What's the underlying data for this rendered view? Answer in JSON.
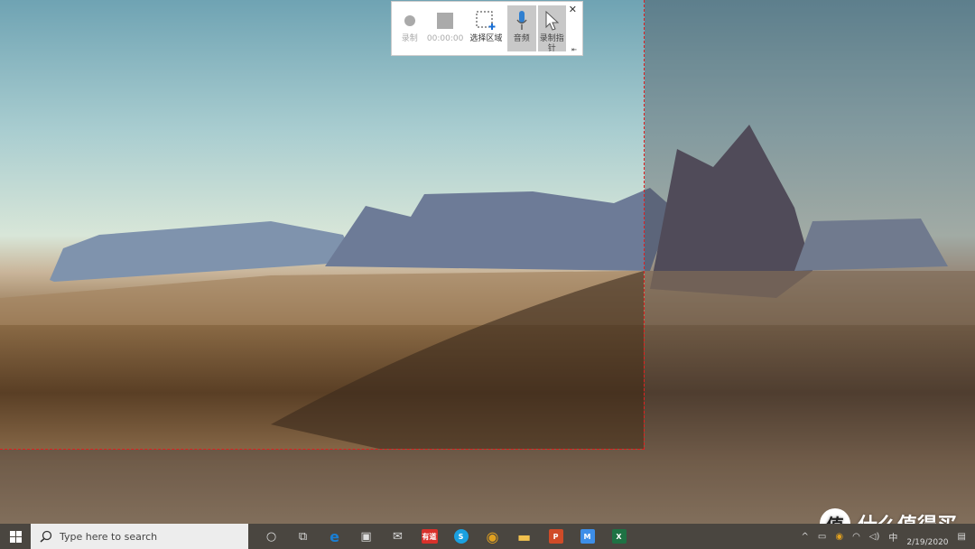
{
  "toolbar": {
    "items": [
      {
        "label": "录制",
        "icon": "record-icon",
        "state": "disabled"
      },
      {
        "label": "00:00:00",
        "icon": "stop-icon",
        "state": "disabled"
      },
      {
        "label": "选择区域",
        "icon": "select-area-icon",
        "state": "enabled"
      },
      {
        "label": "音频",
        "icon": "microphone-icon",
        "state": "active"
      },
      {
        "label": "录制指针",
        "icon": "pointer-icon",
        "state": "active"
      }
    ],
    "close": "✕",
    "pin": "⇤"
  },
  "taskbar": {
    "search_placeholder": "Type here to search",
    "apps": [
      {
        "name": "cortana",
        "glyph": "○"
      },
      {
        "name": "task-view",
        "glyph": "⧉"
      },
      {
        "name": "edge",
        "glyph": "e",
        "color": "#1a7fd4"
      },
      {
        "name": "store",
        "glyph": "▣",
        "color": "#f0f0f0"
      },
      {
        "name": "mail",
        "glyph": "✉",
        "color": "#eeeeee"
      },
      {
        "name": "youdao",
        "glyph": "有道",
        "color": "#d9312b"
      },
      {
        "name": "skype",
        "glyph": "S",
        "color": "#1aa0e0"
      },
      {
        "name": "chrome",
        "glyph": "◉",
        "color": "#e0a020"
      },
      {
        "name": "file-explorer",
        "glyph": "▬",
        "color": "#f2c14e"
      },
      {
        "name": "powerpoint",
        "glyph": "P",
        "color": "#d04b28"
      },
      {
        "name": "feishu",
        "glyph": "M",
        "color": "#3d8ee8"
      },
      {
        "name": "excel",
        "glyph": "X",
        "color": "#1f7244"
      }
    ],
    "tray": {
      "chevron": "^",
      "input": "中",
      "date": "2/19/2020"
    }
  },
  "watermark": {
    "logo": "值",
    "text": "什么值得买"
  }
}
